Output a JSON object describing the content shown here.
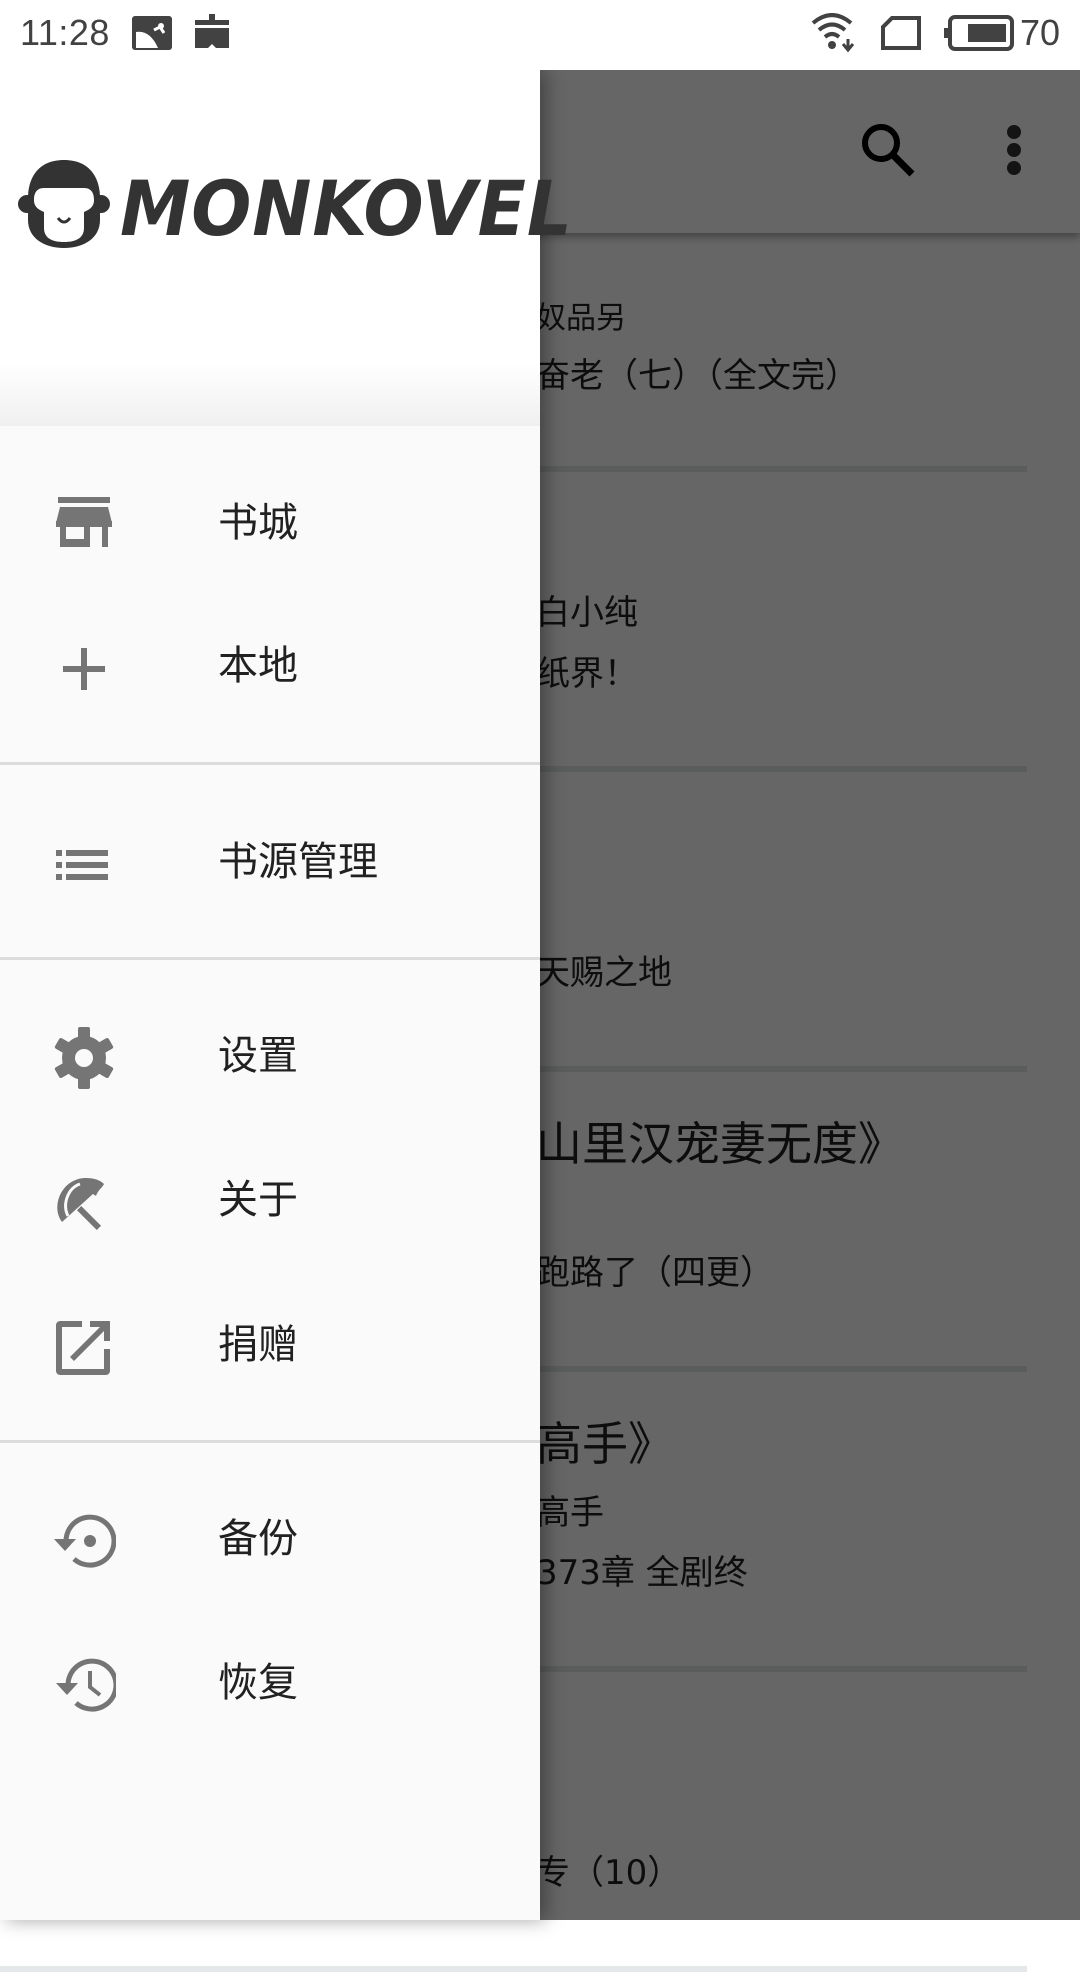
{
  "status_bar": {
    "time": "11:28",
    "left_icons": [
      "image-notification-icon",
      "calendar-notification-icon"
    ],
    "right_icons": [
      "wifi-download-icon",
      "sim-card-icon",
      "battery-icon"
    ],
    "battery_level": "70"
  },
  "toolbar": {
    "actions": [
      "search-icon",
      "more-vert-icon"
    ]
  },
  "background_list": {
    "lines": [
      {
        "text": "奴品另",
        "size": "small"
      },
      {
        "text": "奋老（七）（全文完）",
        "size": "medium"
      },
      {
        "text": "白小纯",
        "size": "medium"
      },
      {
        "text": "纸界！",
        "size": "medium"
      },
      {
        "text": "天赐之地",
        "size": "medium"
      },
      {
        "text": "山里汉宠妻无度》",
        "size": "large"
      },
      {
        "text": "跑路了（四更）",
        "size": "medium"
      },
      {
        "text": "高手》",
        "size": "large"
      },
      {
        "text": "高手",
        "size": "medium"
      },
      {
        "text": "373章 全剧终",
        "size": "medium"
      },
      {
        "text": "专（10）",
        "size": "medium"
      }
    ]
  },
  "drawer": {
    "logo_text": "MONKOVEL",
    "sections": [
      [
        {
          "label": "书城",
          "icon": "store-icon"
        },
        {
          "label": "本地",
          "icon": "add-icon"
        }
      ],
      [
        {
          "label": "书源管理",
          "icon": "list-icon"
        }
      ],
      [
        {
          "label": "设置",
          "icon": "settings-gear-icon"
        },
        {
          "label": "关于",
          "icon": "beach-umbrella-icon"
        },
        {
          "label": "捐赠",
          "icon": "open-external-icon"
        }
      ],
      [
        {
          "label": "备份",
          "icon": "backup-restore-icon"
        },
        {
          "label": "恢复",
          "icon": "history-icon"
        }
      ]
    ]
  },
  "colors": {
    "drawer_bg": "#fafafa",
    "menu_icon": "#757575",
    "menu_text": "#212121",
    "divider": "#dcdcdc",
    "scrim": "#666666"
  }
}
